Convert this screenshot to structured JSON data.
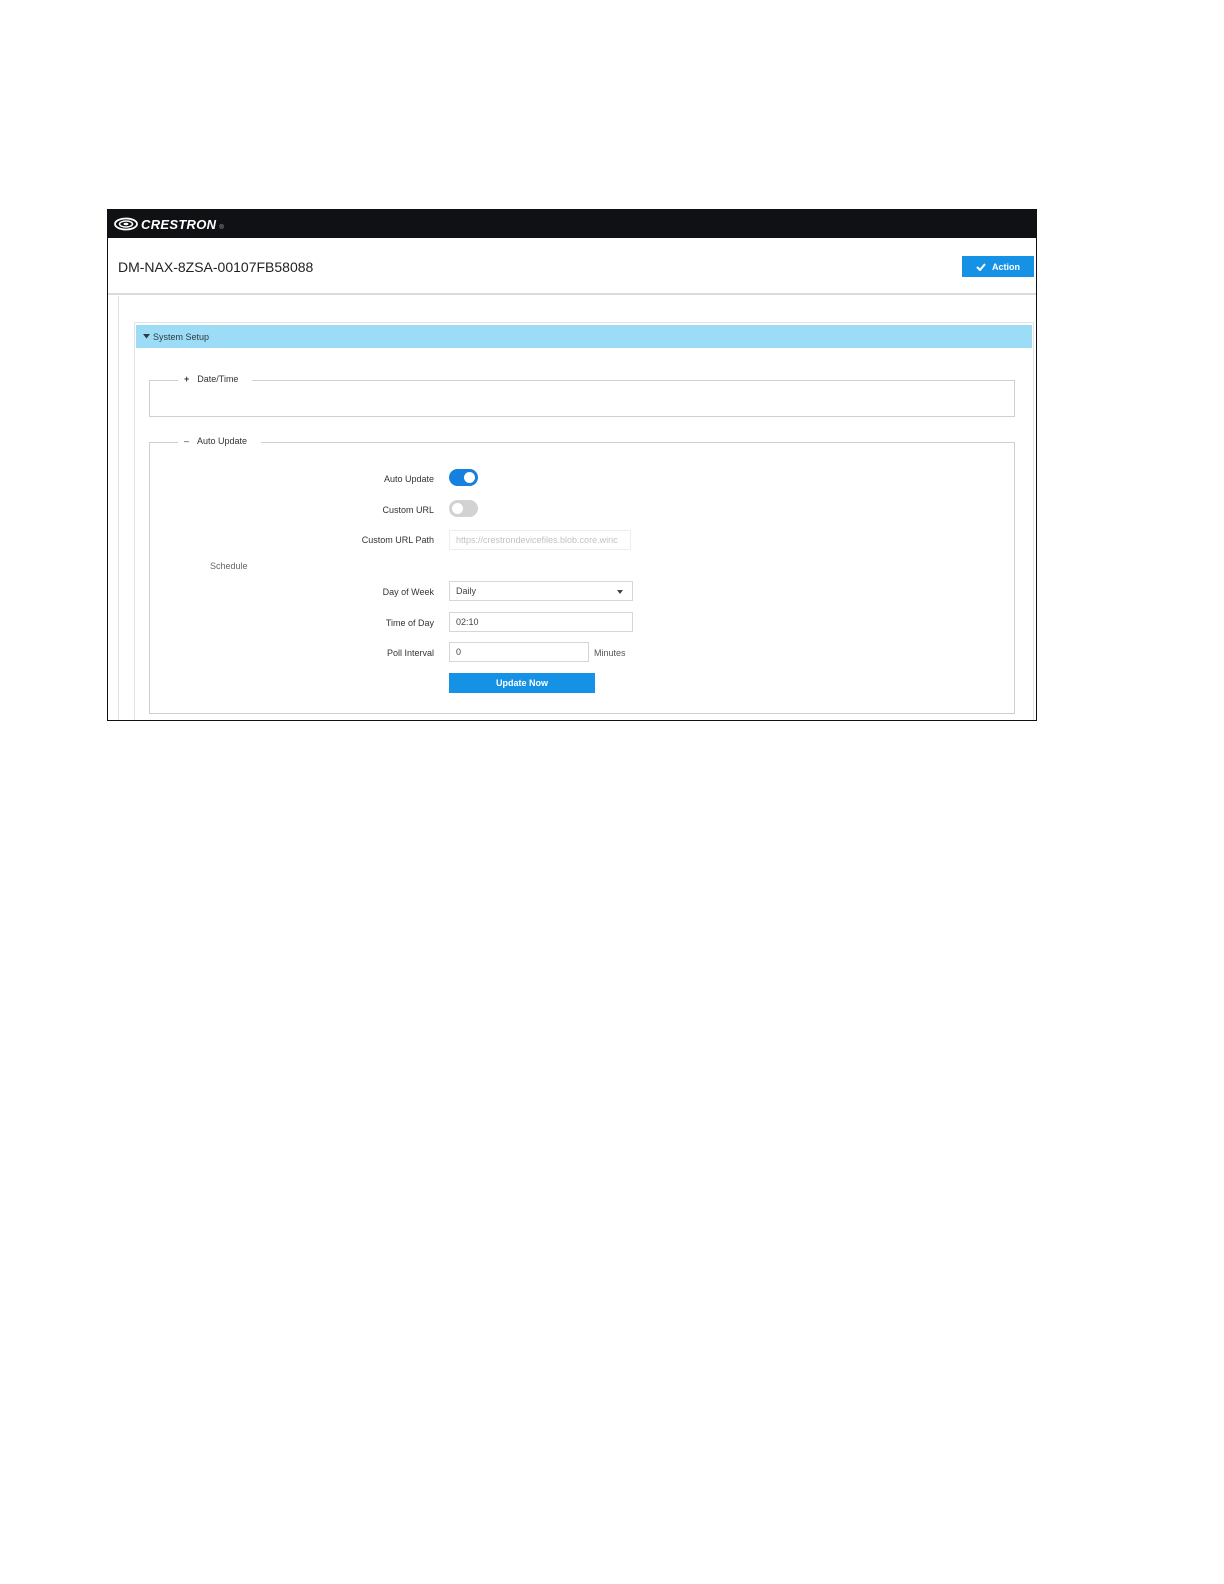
{
  "app": {
    "brand": "CRESTRON",
    "brand_mark": "®"
  },
  "header": {
    "device_title": "DM-NAX-8ZSA-00107FB58088",
    "action_label": "Action"
  },
  "section": {
    "title": "System Setup"
  },
  "date_time": {
    "toggle_symbol": "+",
    "title": "Date/Time"
  },
  "auto_update": {
    "toggle_symbol": "–",
    "title": "Auto Update",
    "auto_update_label": "Auto Update",
    "auto_update_enabled": true,
    "custom_url_label": "Custom URL",
    "custom_url_enabled": false,
    "custom_url_path_label": "Custom URL Path",
    "custom_url_path_placeholder": "https://crestrondevicefiles.blob.core.winc",
    "schedule_label": "Schedule",
    "day_of_week_label": "Day of Week",
    "day_of_week_value": "Daily",
    "time_of_day_label": "Time of Day",
    "time_of_day_value": "02:10",
    "poll_interval_label": "Poll Interval",
    "poll_interval_value": "0",
    "poll_interval_unit": "Minutes",
    "update_now_label": "Update Now"
  },
  "colors": {
    "accent": "#1592e6",
    "section_bar": "#9ddcf7",
    "topbar": "#0f1114",
    "toggle_on": "#1580de",
    "toggle_off": "#d2d2d2"
  }
}
